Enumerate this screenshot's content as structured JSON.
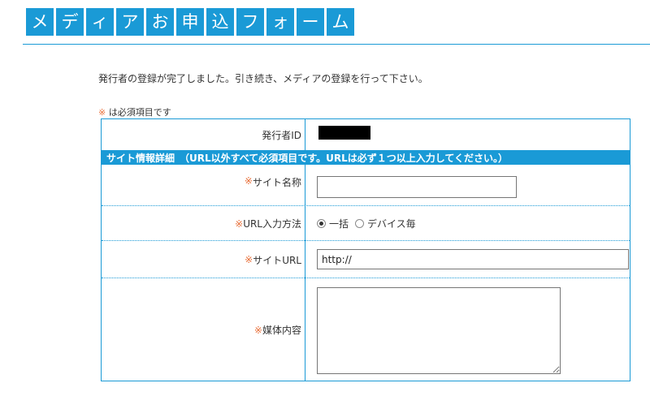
{
  "header": {
    "title_chars": [
      "メ",
      "デ",
      "ィ",
      "ア",
      "お",
      "申",
      "込",
      "フ",
      "ォ",
      "ー",
      "ム"
    ]
  },
  "intro_text": "発行者の登録が完了しました。引き続き、メディアの登録を行って下さい。",
  "required_note": {
    "mark": "※",
    "text": " は必須項目です"
  },
  "form": {
    "publisher_id": {
      "label": "発行者ID",
      "value_redacted": true
    },
    "section_header": "サイト情報詳細　（URL以外すべて必須項目です。URLは必ず１つ以上入力してください。）",
    "site_name": {
      "mark": "※",
      "label": " サイト名称",
      "value": ""
    },
    "url_input_method": {
      "mark": "※",
      "label": " URL入力方法",
      "options": [
        {
          "label": "一括",
          "checked": true
        },
        {
          "label": "デバイス毎",
          "checked": false
        }
      ]
    },
    "site_url": {
      "mark": "※",
      "label": " サイトURL",
      "value": "http://"
    },
    "media_content": {
      "mark": "※",
      "label": " 媒体内容",
      "value": ""
    }
  },
  "colors": {
    "accent": "#1a9ad6",
    "required_mark": "#e8703a"
  }
}
